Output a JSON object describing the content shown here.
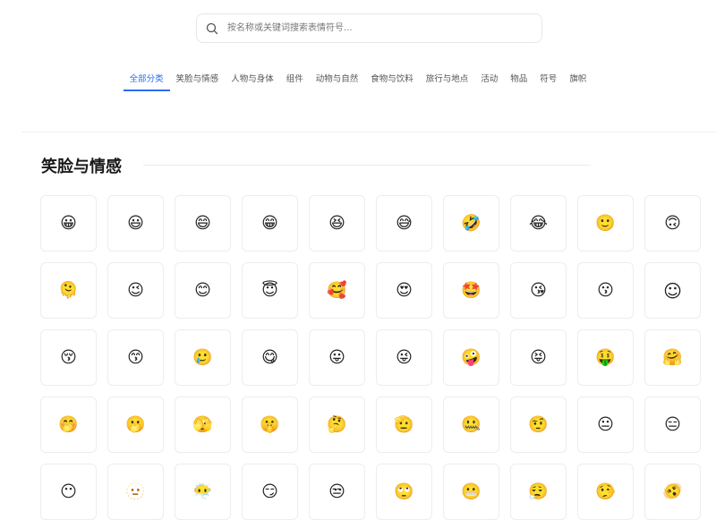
{
  "search": {
    "placeholder": "按名称或关键词搜索表情符号...",
    "value": ""
  },
  "tabs": [
    {
      "label": "全部分类",
      "active": true
    },
    {
      "label": "笑脸与情感"
    },
    {
      "label": "人物与身体"
    },
    {
      "label": "组件"
    },
    {
      "label": "动物与自然"
    },
    {
      "label": "食物与饮料"
    },
    {
      "label": "旅行与地点"
    },
    {
      "label": "活动"
    },
    {
      "label": "物品"
    },
    {
      "label": "符号"
    },
    {
      "label": "旗帜"
    }
  ],
  "section": {
    "title": "笑脸与情感"
  },
  "emojis": [
    "😀",
    "😃",
    "😄",
    "😁",
    "😆",
    "😅",
    "🤣",
    "😂",
    "🙂",
    "🙃",
    "🫠",
    "😉",
    "😊",
    "😇",
    "🥰",
    "😍",
    "🤩",
    "😘",
    "😗",
    "☺",
    "😚",
    "😙",
    "🥲",
    "😋",
    "😛",
    "😜",
    "🤪",
    "😝",
    "🤑",
    "🤗",
    "🤭",
    "🫢",
    "🫣",
    "🤫",
    "🤔",
    "🫡",
    "🤐",
    "🤨",
    "😐",
    "😑",
    "😶",
    "🫥",
    "😶‍🌫️",
    "😏",
    "😒",
    "🙄",
    "😬",
    "😮‍💨",
    "🤥",
    "🫨"
  ]
}
